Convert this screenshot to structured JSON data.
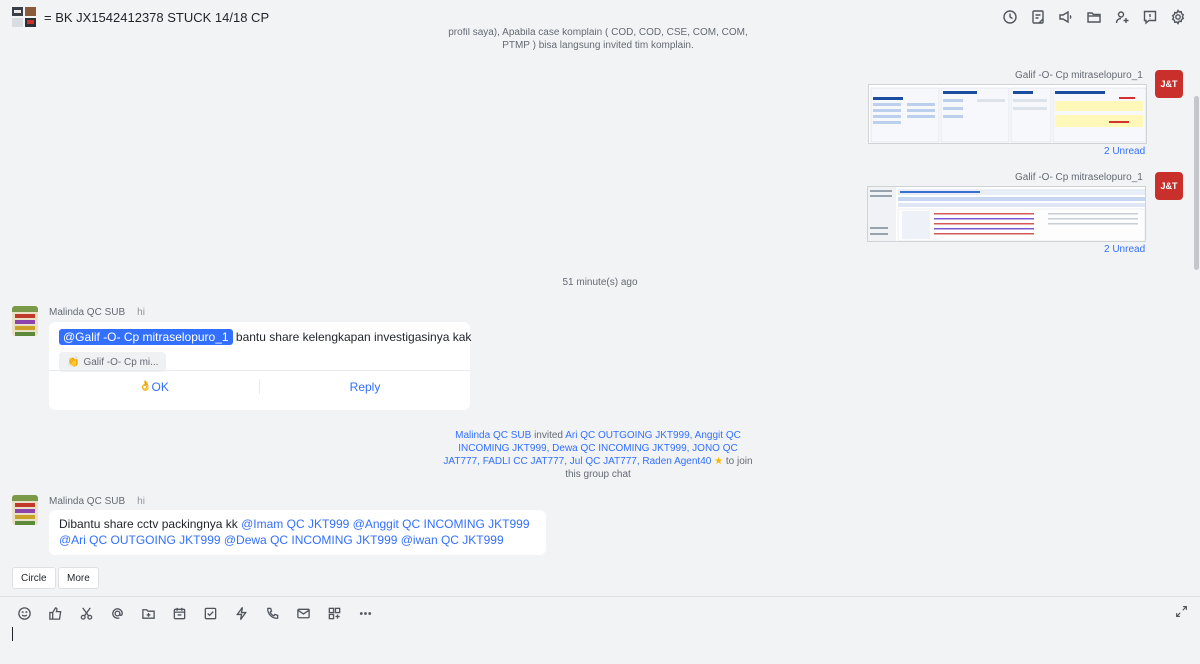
{
  "header": {
    "title": "= BK JX1542412378 STUCK 14/18 CP",
    "icons": [
      "history-icon",
      "notes-icon",
      "announcement-icon",
      "folder-icon",
      "add-member-icon",
      "topic-icon",
      "settings-icon"
    ]
  },
  "messages": {
    "system_notice": "profil saya), Apabila case komplain ( COD, COD, CSE, COM, COM, PTMP ) bisa langsung invited tim komplain.",
    "outgoing": [
      {
        "sender": "Galif -O- Cp mitraselopuro_1",
        "status": "2 Unread"
      },
      {
        "sender": "Galif -O- Cp mitraselopuro_1",
        "status": "2 Unread"
      }
    ],
    "time_divider": "51 minute(s) ago",
    "incoming_1": {
      "sender": "Malinda QC SUB",
      "extra": "hi",
      "mention": "@Galif -O- Cp mitraselopuro_1",
      "text": " bantu share kelengkapan investigasinya kak",
      "reaction": "Galif -O- Cp mi...",
      "ok_label": "OK",
      "reply_label": "Reply"
    },
    "invite_notice": {
      "inviter": "Malinda QC SUB",
      "verb": " invited ",
      "invitees": "Ari QC OUTGOING JKT999, Anggit QC INCOMING JKT999, Dewa QC INCOMING JKT999, JONO QC JAT777, FADLI CC JAT777, Jul QC JAT777, Raden Agent40",
      "suffix": " to join this group chat"
    },
    "incoming_2": {
      "sender": "Malinda QC SUB",
      "extra": "hi",
      "text_prefix": "Dibantu share cctv packingnya kk ",
      "mentions": "@Imam QC JKT999 @Anggit QC INCOMING JKT999 @Ari QC OUTGOING JKT999 @Dewa QC INCOMING JKT999 @iwan QC JKT999"
    }
  },
  "quick_actions": {
    "circle": "Circle",
    "more": "More"
  },
  "composer": {
    "tools": [
      "emoji-icon",
      "thumbs-up-icon",
      "scissors-icon",
      "at-icon",
      "new-folder-icon",
      "calendar-icon",
      "task-icon",
      "lightning-icon",
      "call-icon",
      "mail-icon",
      "apps-icon",
      "more-icon"
    ],
    "value": ""
  },
  "colors": {
    "accent": "#3370ff",
    "background": "#f2f3f5",
    "bubble": "#ffffff",
    "avatar_red": "#c9302c"
  }
}
